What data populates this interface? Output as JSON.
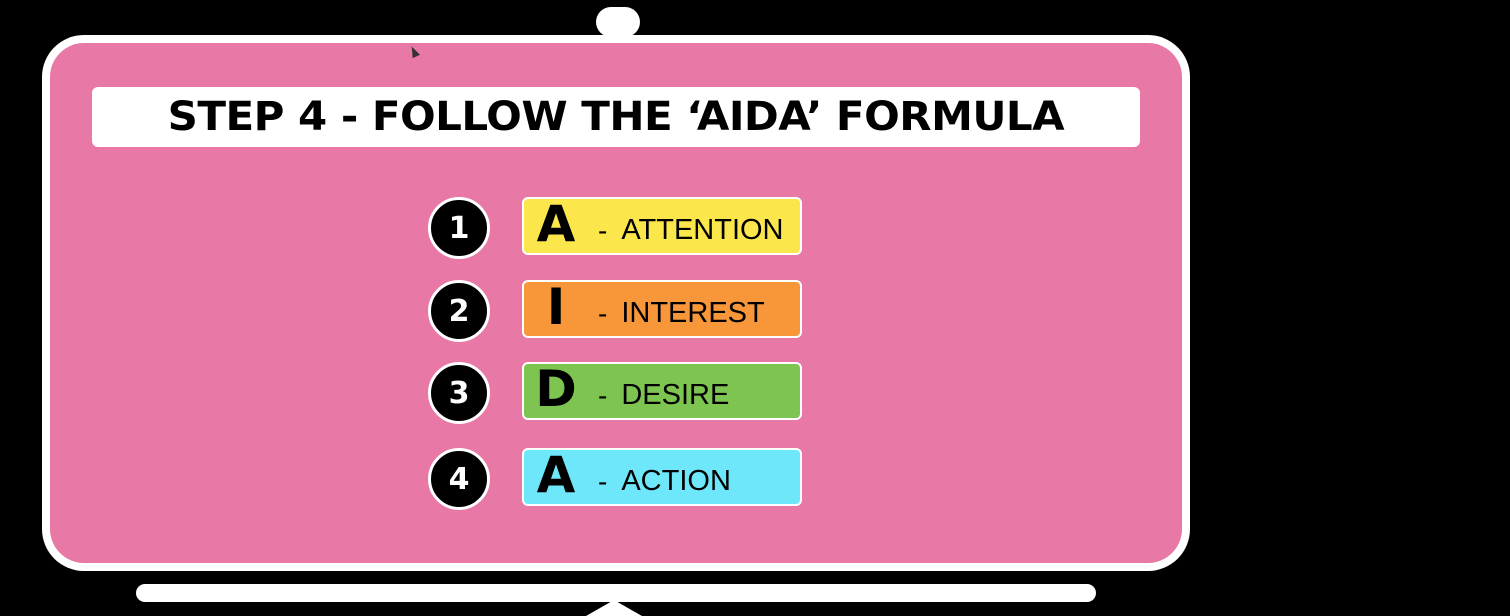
{
  "slide": {
    "title": "STEP 4 - FOLLOW THE ‘AIDA’ FORMULA",
    "steps": [
      {
        "number": "1",
        "letter": "A",
        "dash": "-",
        "word": "ATTENTION",
        "color": "#fbe64b"
      },
      {
        "number": "2",
        "letter": "I",
        "dash": "-",
        "word": "INTEREST",
        "color": "#f7973a"
      },
      {
        "number": "3",
        "letter": "D",
        "dash": "-",
        "word": "DESIRE",
        "color": "#7ec450"
      },
      {
        "number": "4",
        "letter": "A",
        "dash": "-",
        "word": "ACTION",
        "color": "#6ee7fb"
      }
    ]
  },
  "theme": {
    "board_color": "#e878a6",
    "frame_color": "#ffffff",
    "background": "#000000"
  },
  "icons": {
    "cursor": "mouse-pointer-icon"
  }
}
